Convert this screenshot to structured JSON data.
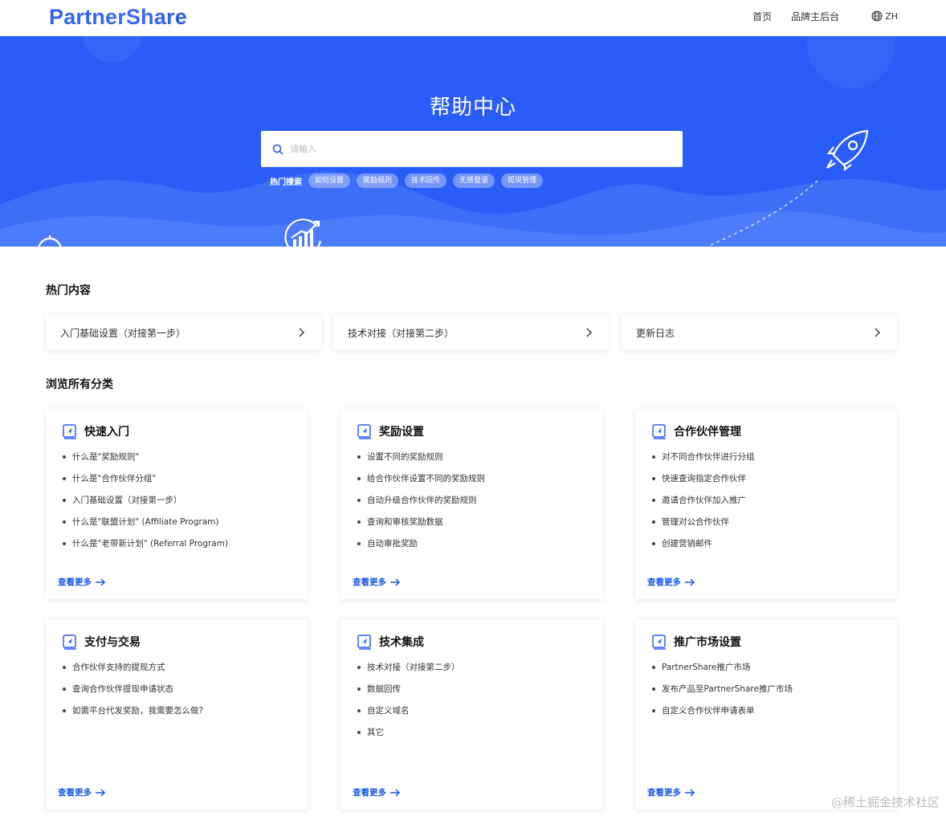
{
  "header": {
    "logo": "PartnerShare",
    "nav": [
      "首页",
      "品牌主后台"
    ],
    "lang": "ZH"
  },
  "hero": {
    "title": "帮助中心",
    "search_placeholder": "请输入",
    "hot_label": "热门搜索",
    "hot_tags": [
      "如何设置",
      "奖励规则",
      "技术回传",
      "无感登录",
      "提现管理"
    ]
  },
  "popular": {
    "title": "热门内容",
    "items": [
      "入门基础设置（对接第一步）",
      "技术对接（对接第二步）",
      "更新日志"
    ]
  },
  "categories": {
    "title": "浏览所有分类",
    "more_label": "查看更多",
    "cards": [
      {
        "title": "快速入门",
        "items": [
          "什么是\"奖励规则\"",
          "什么是\"合作伙伴分组\"",
          "入门基础设置（对接第一步）",
          "什么是\"联盟计划\" (Affiliate Program)",
          "什么是\"老带新计划\" (Referral Program)"
        ]
      },
      {
        "title": "奖励设置",
        "items": [
          "设置不同的奖励规则",
          "给合作伙伴设置不同的奖励规则",
          "自动升级合作伙伴的奖励规则",
          "查询和审核奖励数据",
          "自动审批奖励"
        ]
      },
      {
        "title": "合作伙伴管理",
        "items": [
          "对不同合作伙伴进行分组",
          "快速查询指定合作伙伴",
          "邀请合作伙伴加入推广",
          "管理对公合作伙伴",
          "创建营销邮件"
        ]
      },
      {
        "title": "支付与交易",
        "items": [
          "合作伙伴支持的提现方式",
          "查询合作伙伴提现申请状态",
          "如需平台代发奖励，我需要怎么做?"
        ]
      },
      {
        "title": "技术集成",
        "items": [
          "技术对接（对接第二步）",
          "数据回传",
          "自定义域名",
          "其它"
        ]
      },
      {
        "title": "推广市场设置",
        "items": [
          "PartnerShare推广市场",
          "发布产品至PartnerShare推广市场",
          "自定义合作伙伴申请表单"
        ]
      }
    ]
  },
  "watermark": "@稀土掘金技术社区",
  "colors": {
    "brand_blue": "#2a5df7",
    "link_blue": "#1a57e6"
  }
}
